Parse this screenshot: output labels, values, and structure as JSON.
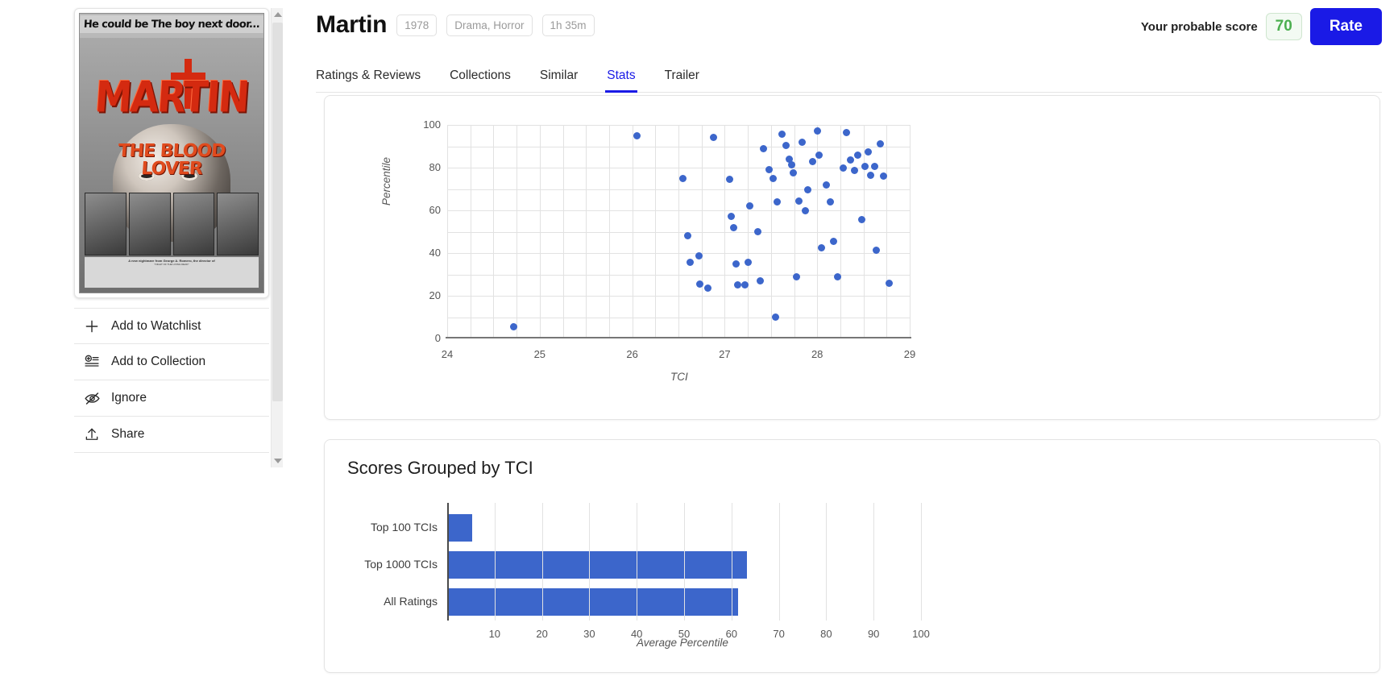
{
  "header": {
    "title": "Martin",
    "chips": [
      "1978",
      "Drama, Horror",
      "1h 35m"
    ],
    "probable_score_label": "Your probable score",
    "probable_score_value": "70",
    "rate_button": "Rate",
    "accent_color": "#1a1ae6",
    "score_color": "#4caf50"
  },
  "tabs": [
    {
      "label": "Ratings & Reviews",
      "active": false
    },
    {
      "label": "Collections",
      "active": false
    },
    {
      "label": "Similar",
      "active": false
    },
    {
      "label": "Stats",
      "active": true
    },
    {
      "label": "Trailer",
      "active": false
    }
  ],
  "sidebar": {
    "poster": {
      "tagline": "He could be The boy next door...",
      "title": "MARTIN",
      "subtitle_line1": "THE BLOOD",
      "subtitle_line2": "LOVER",
      "credits_headline": "A new nightmare from George A. Romero, the director of",
      "credits_body": "\"NIGHT OF THE LIVING DEAD\""
    },
    "actions": [
      {
        "icon": "plus-icon",
        "label": "Add to Watchlist"
      },
      {
        "icon": "add-to-collection-icon",
        "label": "Add to Collection"
      },
      {
        "icon": "eye-off-icon",
        "label": "Ignore"
      },
      {
        "icon": "share-icon",
        "label": "Share"
      }
    ]
  },
  "chart_data": [
    {
      "id": "percentile-vs-tci",
      "type": "scatter",
      "title": "",
      "xlabel": "TCI",
      "ylabel": "Percentile",
      "xlim": [
        24,
        29
      ],
      "ylim": [
        0,
        100
      ],
      "xticks": [
        24,
        25,
        26,
        27,
        28,
        29
      ],
      "yticks": [
        0,
        20,
        40,
        60,
        80,
        100
      ],
      "grid": true,
      "point_color": "#3c66cb",
      "points": [
        [
          24.72,
          5.5
        ],
        [
          26.05,
          95.0
        ],
        [
          26.55,
          75.0
        ],
        [
          26.6,
          48.0
        ],
        [
          26.63,
          35.5
        ],
        [
          26.72,
          38.5
        ],
        [
          26.73,
          25.5
        ],
        [
          26.82,
          23.5
        ],
        [
          26.88,
          94.0
        ],
        [
          27.05,
          74.5
        ],
        [
          27.07,
          57.0
        ],
        [
          27.1,
          52.0
        ],
        [
          27.12,
          35.0
        ],
        [
          27.14,
          25.0
        ],
        [
          27.22,
          25.0
        ],
        [
          27.25,
          35.5
        ],
        [
          27.27,
          62.0
        ],
        [
          27.36,
          50.0
        ],
        [
          27.38,
          27.0
        ],
        [
          27.42,
          89.0
        ],
        [
          27.48,
          79.0
        ],
        [
          27.52,
          75.0
        ],
        [
          27.55,
          10.0
        ],
        [
          27.57,
          64.0
        ],
        [
          27.62,
          95.5
        ],
        [
          27.66,
          90.5
        ],
        [
          27.7,
          84.0
        ],
        [
          27.72,
          81.5
        ],
        [
          27.74,
          77.5
        ],
        [
          27.78,
          29.0
        ],
        [
          27.8,
          64.5
        ],
        [
          27.84,
          92.0
        ],
        [
          27.87,
          60.0
        ],
        [
          27.9,
          69.5
        ],
        [
          27.95,
          83.0
        ],
        [
          28.0,
          97.0
        ],
        [
          28.02,
          86.0
        ],
        [
          28.05,
          42.5
        ],
        [
          28.1,
          72.0
        ],
        [
          28.14,
          64.0
        ],
        [
          28.18,
          45.5
        ],
        [
          28.22,
          29.0
        ],
        [
          28.28,
          80.0
        ],
        [
          28.32,
          96.5
        ],
        [
          28.36,
          83.5
        ],
        [
          28.4,
          78.5
        ],
        [
          28.44,
          86.0
        ],
        [
          28.48,
          55.5
        ],
        [
          28.52,
          80.5
        ],
        [
          28.55,
          87.5
        ],
        [
          28.58,
          76.5
        ],
        [
          28.62,
          80.5
        ],
        [
          28.64,
          41.5
        ],
        [
          28.68,
          91.0
        ],
        [
          28.72,
          76.0
        ],
        [
          28.78,
          26.0
        ]
      ]
    },
    {
      "id": "scores-grouped-by-tci",
      "type": "bar",
      "orientation": "horizontal",
      "title": "Scores Grouped by TCI",
      "xlabel": "Average Percentile",
      "ylabel": "",
      "xlim": [
        0,
        100
      ],
      "xticks": [
        10,
        20,
        30,
        40,
        50,
        60,
        70,
        80,
        90,
        100
      ],
      "grid": true,
      "bar_color": "#3c66cb",
      "categories": [
        "Top 100 TCIs",
        "Top 1000 TCIs",
        "All Ratings"
      ],
      "values": [
        5,
        63,
        61
      ]
    }
  ]
}
